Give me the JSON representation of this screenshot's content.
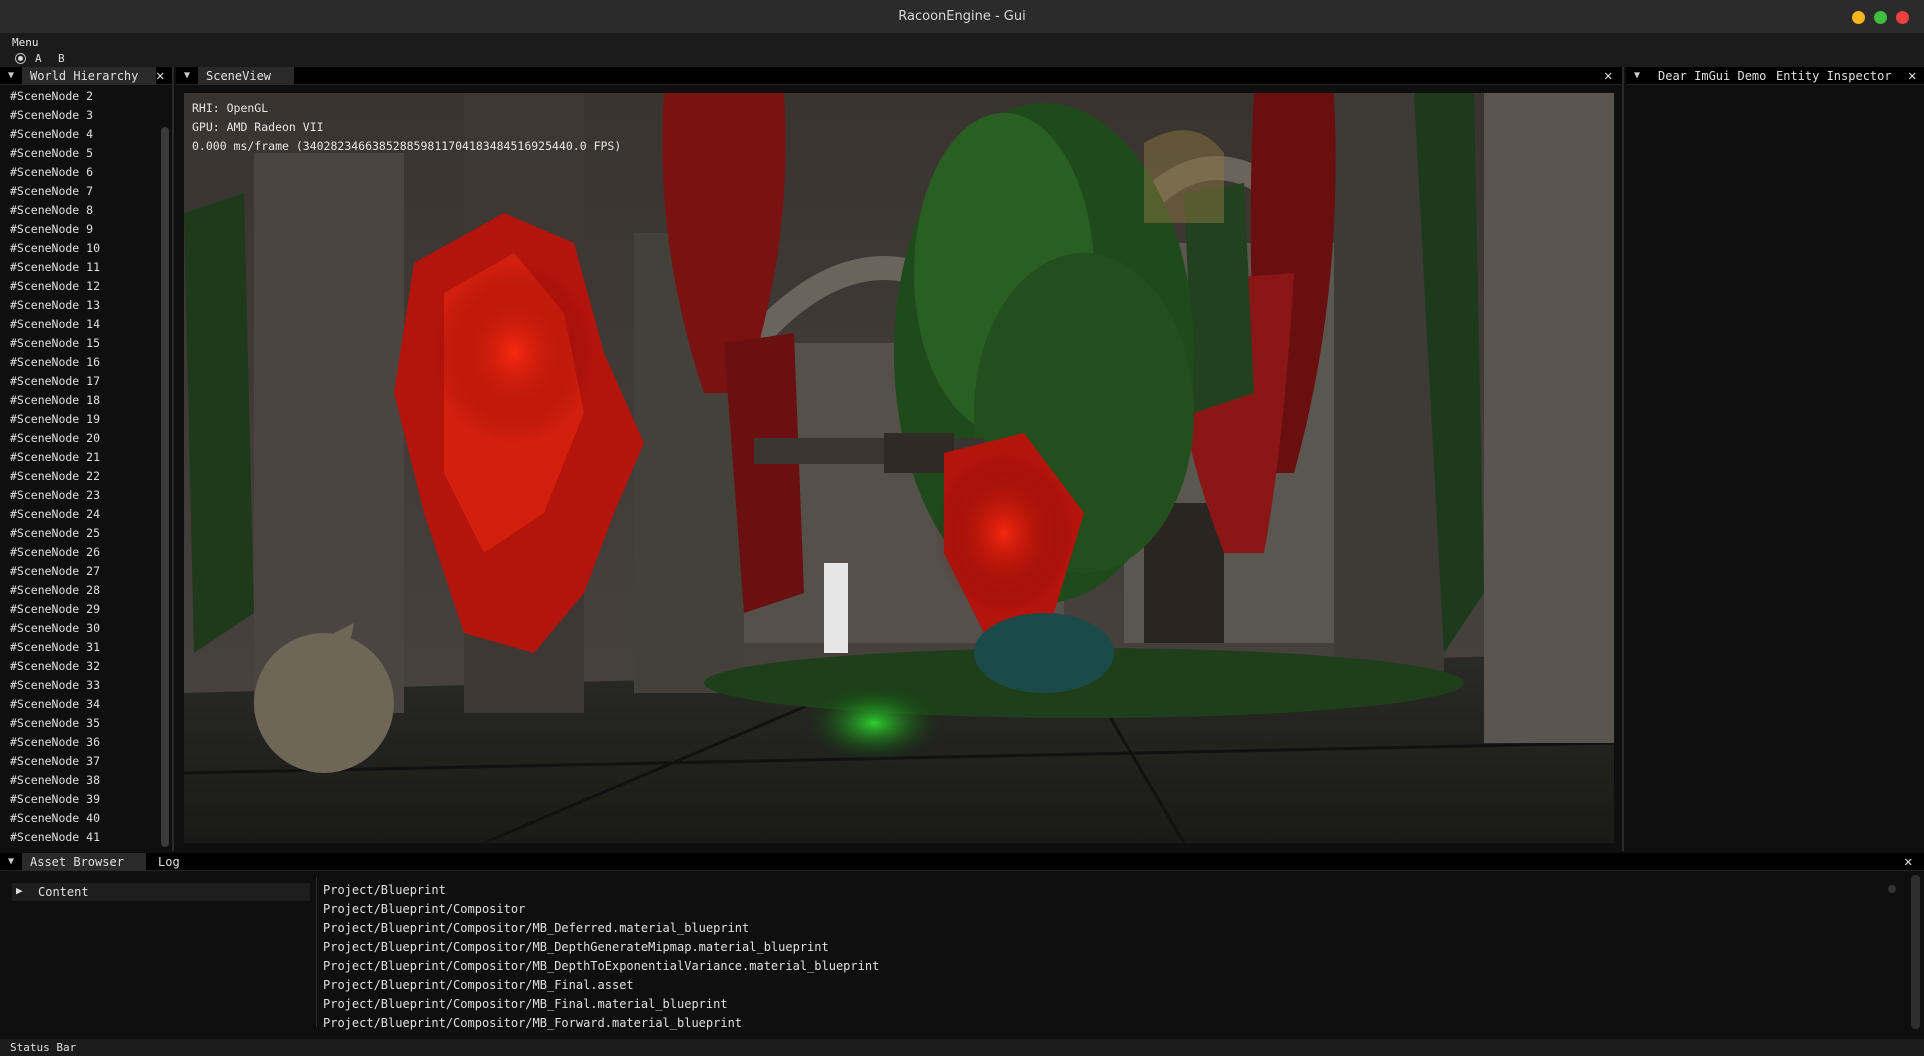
{
  "window": {
    "title": "RacoonEngine - Gui",
    "controls": {
      "minimize_color": "#f5b620",
      "maximize_color": "#3fbf3f",
      "close_color": "#f04040"
    }
  },
  "menubar": {
    "menu_label": "Menu"
  },
  "toolbar": {
    "option_a": "A",
    "option_b": "B"
  },
  "hierarchy": {
    "tab_label": "World Hierarchy",
    "items": [
      "#SceneNode 2",
      "#SceneNode 3",
      "#SceneNode 4",
      "#SceneNode 5",
      "#SceneNode 6",
      "#SceneNode 7",
      "#SceneNode 8",
      "#SceneNode 9",
      "#SceneNode 10",
      "#SceneNode 11",
      "#SceneNode 12",
      "#SceneNode 13",
      "#SceneNode 14",
      "#SceneNode 15",
      "#SceneNode 16",
      "#SceneNode 17",
      "#SceneNode 18",
      "#SceneNode 19",
      "#SceneNode 20",
      "#SceneNode 21",
      "#SceneNode 22",
      "#SceneNode 23",
      "#SceneNode 24",
      "#SceneNode 25",
      "#SceneNode 26",
      "#SceneNode 27",
      "#SceneNode 28",
      "#SceneNode 29",
      "#SceneNode 30",
      "#SceneNode 31",
      "#SceneNode 32",
      "#SceneNode 33",
      "#SceneNode 34",
      "#SceneNode 35",
      "#SceneNode 36",
      "#SceneNode 37",
      "#SceneNode 38",
      "#SceneNode 39",
      "#SceneNode 40",
      "#SceneNode 41"
    ]
  },
  "sceneview": {
    "tab_label": "SceneView",
    "rhi": "RHI: OpenGL",
    "gpu": "GPU: AMD Radeon VII",
    "frame_stats": "0.000 ms/frame (340282346638528859811704183484516925440.0 FPS)"
  },
  "rightpanel": {
    "tab_demo": "Dear ImGui Demo",
    "tab_inspector": "Entity Inspector"
  },
  "bottom": {
    "tab_assets": "Asset Browser",
    "tab_log": "Log",
    "tree_root": "Content",
    "assets": [
      "Project/Blueprint",
      "Project/Blueprint/Compositor",
      "Project/Blueprint/Compositor/MB_Deferred.material_blueprint",
      "Project/Blueprint/Compositor/MB_DepthGenerateMipmap.material_blueprint",
      "Project/Blueprint/Compositor/MB_DepthToExponentialVariance.material_blueprint",
      "Project/Blueprint/Compositor/MB_Final.asset",
      "Project/Blueprint/Compositor/MB_Final.material_blueprint",
      "Project/Blueprint/Compositor/MB_Forward.material_blueprint"
    ]
  },
  "statusbar": {
    "text": "Status Bar"
  }
}
